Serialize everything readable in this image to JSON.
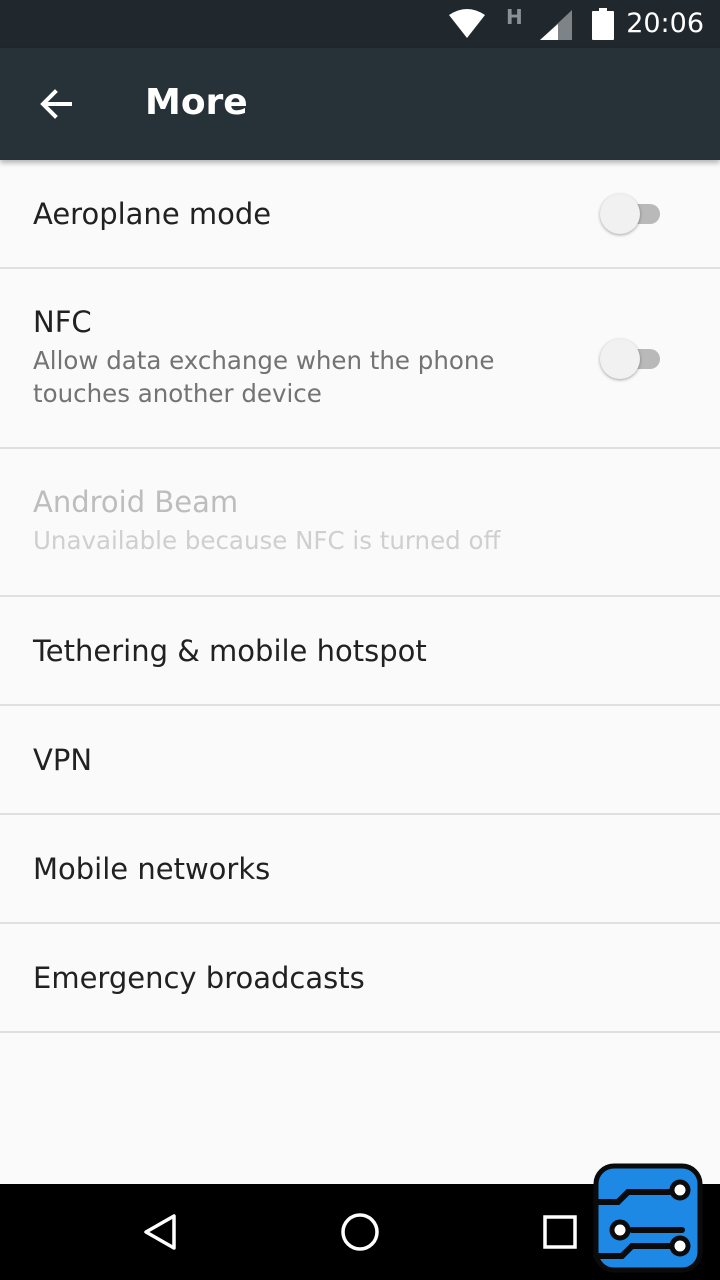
{
  "status_bar": {
    "time": "20:06",
    "network_type": "H",
    "icons": [
      "wifi-icon",
      "signal-icon",
      "battery-icon"
    ]
  },
  "app_bar": {
    "title": "More",
    "back_icon": "arrow-left-icon"
  },
  "settings": {
    "aeroplane": {
      "title": "Aeroplane mode",
      "toggle_on": false
    },
    "nfc": {
      "title": "NFC",
      "subtitle_line1": "Allow data exchange when the phone",
      "subtitle_line2": "touches another device",
      "toggle_on": false
    },
    "beam": {
      "title": "Android Beam",
      "subtitle": "Unavailable because NFC is turned off",
      "enabled": false
    },
    "tethering": {
      "title": "Tethering & mobile hotspot"
    },
    "vpn": {
      "title": "VPN"
    },
    "mobile_networks": {
      "title": "Mobile networks"
    },
    "emergency": {
      "title": "Emergency broadcasts"
    }
  },
  "nav_bar": {
    "icons": [
      "nav-back-icon",
      "nav-home-icon",
      "nav-recents-icon"
    ]
  },
  "colors": {
    "status_bar": "#20282e",
    "app_bar": "#263238",
    "background": "#fafafa",
    "divider": "#e0e0e0",
    "logo_blue": "#1e88e5"
  }
}
